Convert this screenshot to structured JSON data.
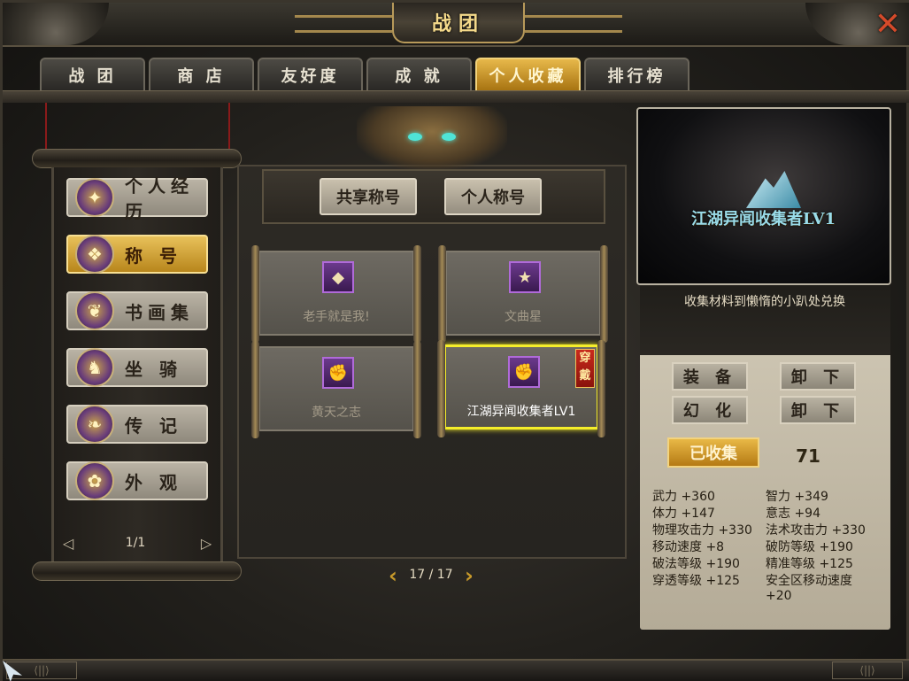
{
  "window": {
    "title": "战团",
    "close_icon": "close-icon"
  },
  "tabs": [
    {
      "label": "战 团",
      "active": false
    },
    {
      "label": "商 店",
      "active": false
    },
    {
      "label": "友好度",
      "active": false
    },
    {
      "label": "成 就",
      "active": false
    },
    {
      "label": "个人收藏",
      "active": true
    },
    {
      "label": "排行榜",
      "active": false
    }
  ],
  "sidebar": {
    "items": [
      {
        "label": "个人经历",
        "icon": "journey-icon",
        "active": false
      },
      {
        "label": "称 号",
        "icon": "title-icon",
        "active": true
      },
      {
        "label": "书画集",
        "icon": "scroll-icon",
        "active": false
      },
      {
        "label": "坐 骑",
        "icon": "mount-icon",
        "active": false
      },
      {
        "label": "传 记",
        "icon": "book-icon",
        "active": false
      },
      {
        "label": "外 观",
        "icon": "appearance-icon",
        "active": false
      }
    ],
    "pager": {
      "text": "1/1",
      "prev_icon": "prev-icon",
      "next_icon": "next-icon"
    }
  },
  "subtabs": [
    {
      "label": "共享称号"
    },
    {
      "label": "个人称号"
    }
  ],
  "cards": [
    {
      "name": "老手就是我!",
      "icon": "stone-icon",
      "selected": false,
      "equipped": false
    },
    {
      "name": "文曲星",
      "icon": "star-badge-icon",
      "selected": false,
      "equipped": false
    },
    {
      "name": "黄天之志",
      "icon": "fist-icon",
      "selected": false,
      "equipped": false
    },
    {
      "name": "江湖异闻收集者LV1",
      "icon": "fist-icon",
      "selected": true,
      "equipped": true,
      "tag": "穿戴"
    }
  ],
  "page_nav": {
    "text": "17 / 17"
  },
  "preview": {
    "title": "江湖异闻收集者LV1"
  },
  "detail": {
    "description": "收集材料到懒惰的小趴处兑换",
    "buttons": {
      "equip": "装 备",
      "unequip_1": "卸 下",
      "transform": "幻 化",
      "unequip_2": "卸 下"
    },
    "collected_label": "已收集",
    "collected_count": "71",
    "stats": [
      {
        "label": "武力",
        "value": "+360"
      },
      {
        "label": "智力",
        "value": "+349"
      },
      {
        "label": "体力",
        "value": "+147"
      },
      {
        "label": "意志",
        "value": "+94"
      },
      {
        "label": "物理攻击力",
        "value": "+330"
      },
      {
        "label": "法术攻击力",
        "value": "+330"
      },
      {
        "label": "移动速度",
        "value": "+8"
      },
      {
        "label": "破防等级",
        "value": "+190"
      },
      {
        "label": "破法等级",
        "value": "+190"
      },
      {
        "label": "精准等级",
        "value": "+125"
      },
      {
        "label": "穿透等级",
        "value": "+125"
      },
      {
        "label": "安全区移动速度",
        "value": "+20"
      }
    ]
  }
}
